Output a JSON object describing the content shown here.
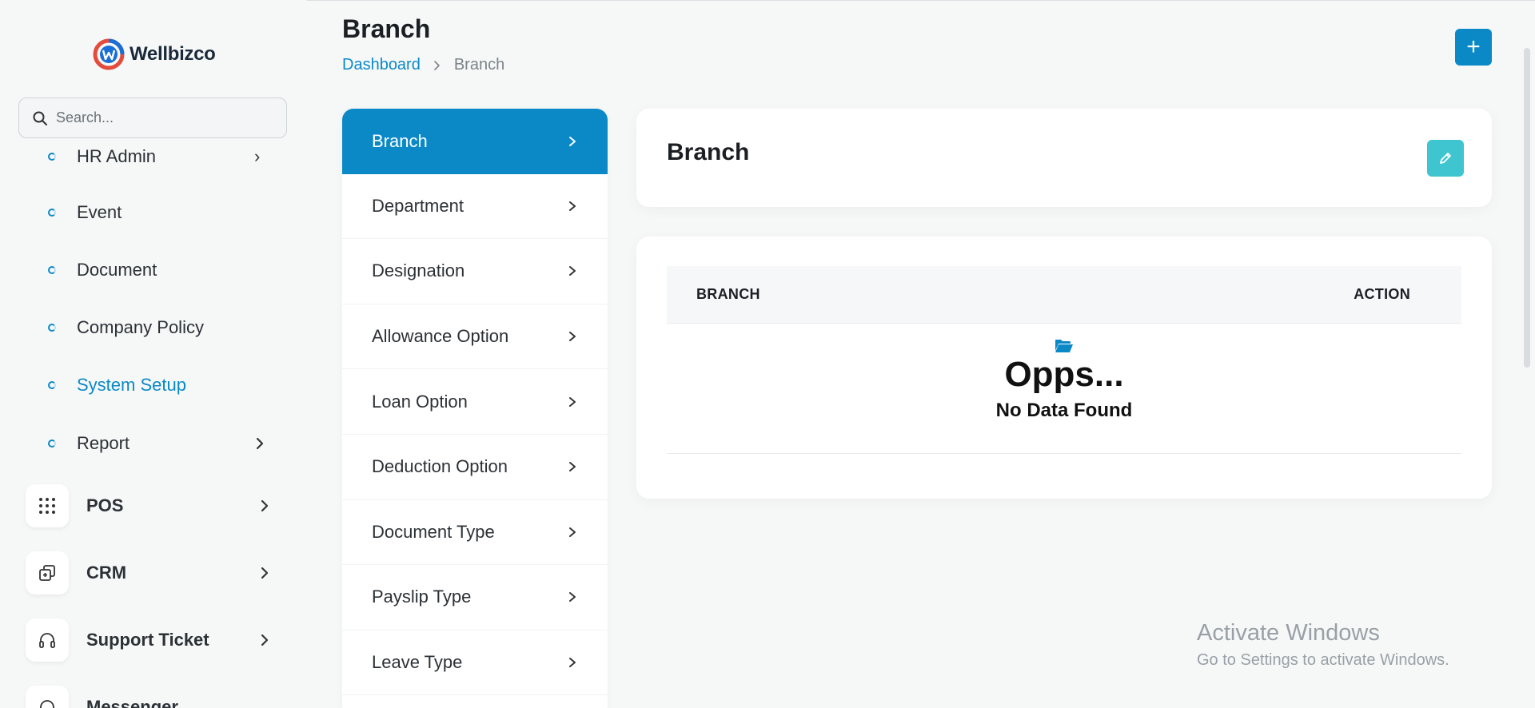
{
  "app": {
    "logo_text": "Wellbizco"
  },
  "search": {
    "placeholder": "Search..."
  },
  "sidebar": {
    "sub_items": [
      {
        "label": "HR Admin"
      },
      {
        "label": "Event"
      },
      {
        "label": "Document"
      },
      {
        "label": "Company Policy"
      },
      {
        "label": "System Setup"
      },
      {
        "label": "Report"
      }
    ],
    "main_items": [
      {
        "label": "POS",
        "icon": "grid-icon"
      },
      {
        "label": "CRM",
        "icon": "crm-icon"
      },
      {
        "label": "Support Ticket",
        "icon": "headphones-icon"
      },
      {
        "label": "Messenger",
        "icon": "chat-icon"
      }
    ]
  },
  "header": {
    "title": "Branch",
    "breadcrumb": {
      "home": "Dashboard",
      "current": "Branch"
    },
    "add_label": "+"
  },
  "setup_menu": {
    "items": [
      {
        "label": "Branch"
      },
      {
        "label": "Department"
      },
      {
        "label": "Designation"
      },
      {
        "label": "Allowance Option"
      },
      {
        "label": "Loan Option"
      },
      {
        "label": "Deduction Option"
      },
      {
        "label": "Document Type"
      },
      {
        "label": "Payslip Type"
      },
      {
        "label": "Leave Type"
      }
    ],
    "active_index": 0
  },
  "content": {
    "title": "Branch",
    "table": {
      "columns": [
        "BRANCH",
        "ACTION"
      ],
      "empty_title": "Opps...",
      "empty_text": "No Data Found"
    }
  },
  "watermark": {
    "line1": "Activate Windows",
    "line2": "Go to Settings to activate Windows."
  },
  "colors": {
    "primary": "#0b89c7",
    "edit": "#3ec5cf",
    "background": "#f6f8f8"
  }
}
